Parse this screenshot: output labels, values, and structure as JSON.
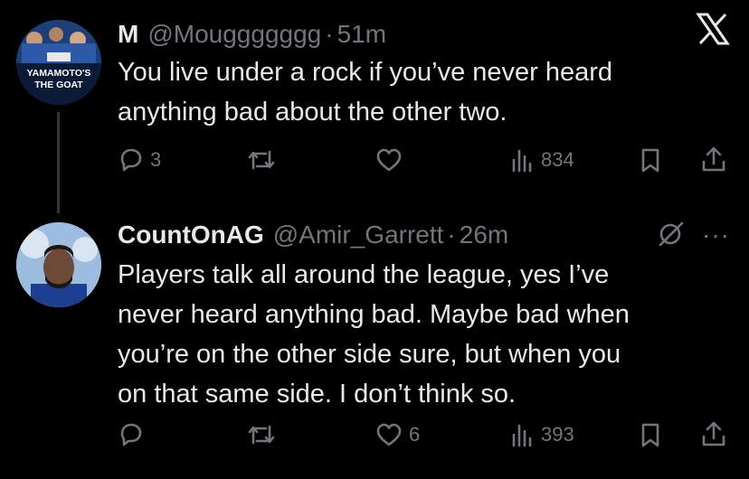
{
  "tweets": [
    {
      "display_name": "M",
      "handle": "@Mouggggggg",
      "separator": "·",
      "time": "51m",
      "avatar_text_line1": "YAMAMOTO'S",
      "avatar_text_line2": "THE GOAT",
      "text": "You live under a rock if you’ve never heard\nanything bad about the other two.",
      "replies": "3",
      "retweets": "",
      "likes": "",
      "views": "834"
    },
    {
      "display_name": "CountOnAG",
      "handle": "@Amir_Garrett",
      "separator": "·",
      "time": "26m",
      "text": "Players talk all around the league, yes I’ve\nnever heard anything bad. Maybe bad when\nyou’re on the other side sure, but when you\non that same side. I don’t think so.",
      "replies": "",
      "retweets": "",
      "likes": "6",
      "views": "393"
    }
  ],
  "icons": {
    "platform": "x-logo-icon",
    "reply": "reply-icon",
    "retweet": "retweet-icon",
    "like": "heart-icon",
    "views": "views-icon",
    "bookmark": "bookmark-icon",
    "share": "share-icon",
    "grok": "grok-icon",
    "more": "more-icon"
  },
  "more_label": "···",
  "colors": {
    "background": "#000000",
    "text": "#e7e9ea",
    "muted": "#71767b",
    "line": "#333639"
  }
}
